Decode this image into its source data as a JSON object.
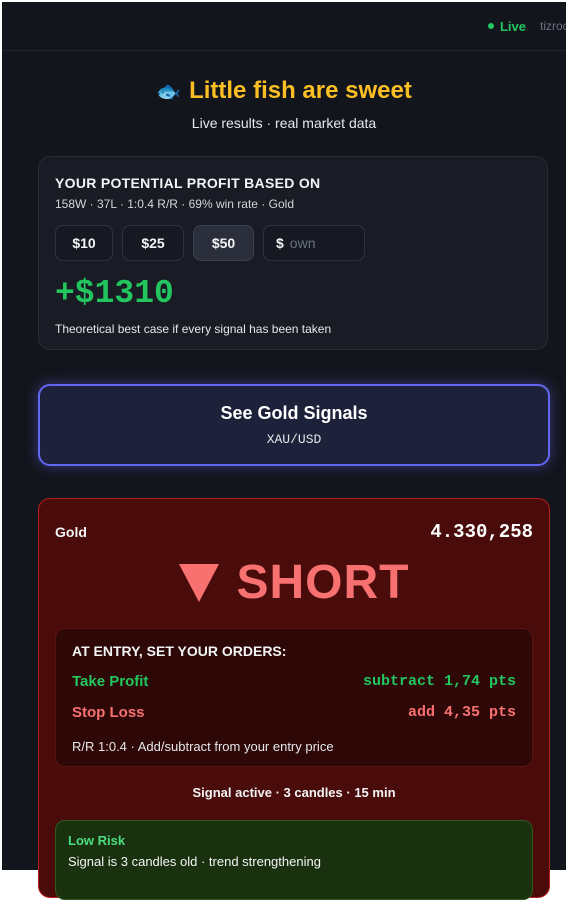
{
  "topbar": {
    "live_label": "Live",
    "user": "tizroo"
  },
  "hero": {
    "icon": "fish-icon",
    "title": "Little fish are sweet",
    "subtitle": "Live results · real market data"
  },
  "profit": {
    "title": "YOUR POTENTIAL PROFIT BASED ON",
    "stats": "158W · 37L · 1:0.4 R/R · 69% win rate · Gold",
    "amounts": [
      "$10",
      "$25",
      "$50"
    ],
    "selected": "$50",
    "own_prefix": "$",
    "own_placeholder": "own",
    "value": "+$1310",
    "note": "Theoretical best case if every signal has been taken"
  },
  "see_signals": {
    "title": "See Gold Signals",
    "subtitle": "XAU/USD"
  },
  "signal": {
    "asset": "Gold",
    "price": "4.330,258",
    "direction": "SHORT",
    "direction_icon": "triangle-down-icon",
    "orders_title": "AT ENTRY, SET YOUR ORDERS:",
    "take_profit_label": "Take Profit",
    "take_profit_value": "subtract 1,74 pts",
    "stop_loss_label": "Stop Loss",
    "stop_loss_value": "add 4,35 pts",
    "rr_note": "R/R 1:0.4 · Add/subtract from your entry price",
    "active": "Signal active · 3 candles · 15 min",
    "risk_title": "Low Risk",
    "risk_text": "Signal is 3 candles old · trend strengthening"
  },
  "colors": {
    "bg": "#13151c",
    "gold": "#fbbf24",
    "green": "#22c55e",
    "red": "#f87171",
    "indigo": "#6366f1"
  }
}
